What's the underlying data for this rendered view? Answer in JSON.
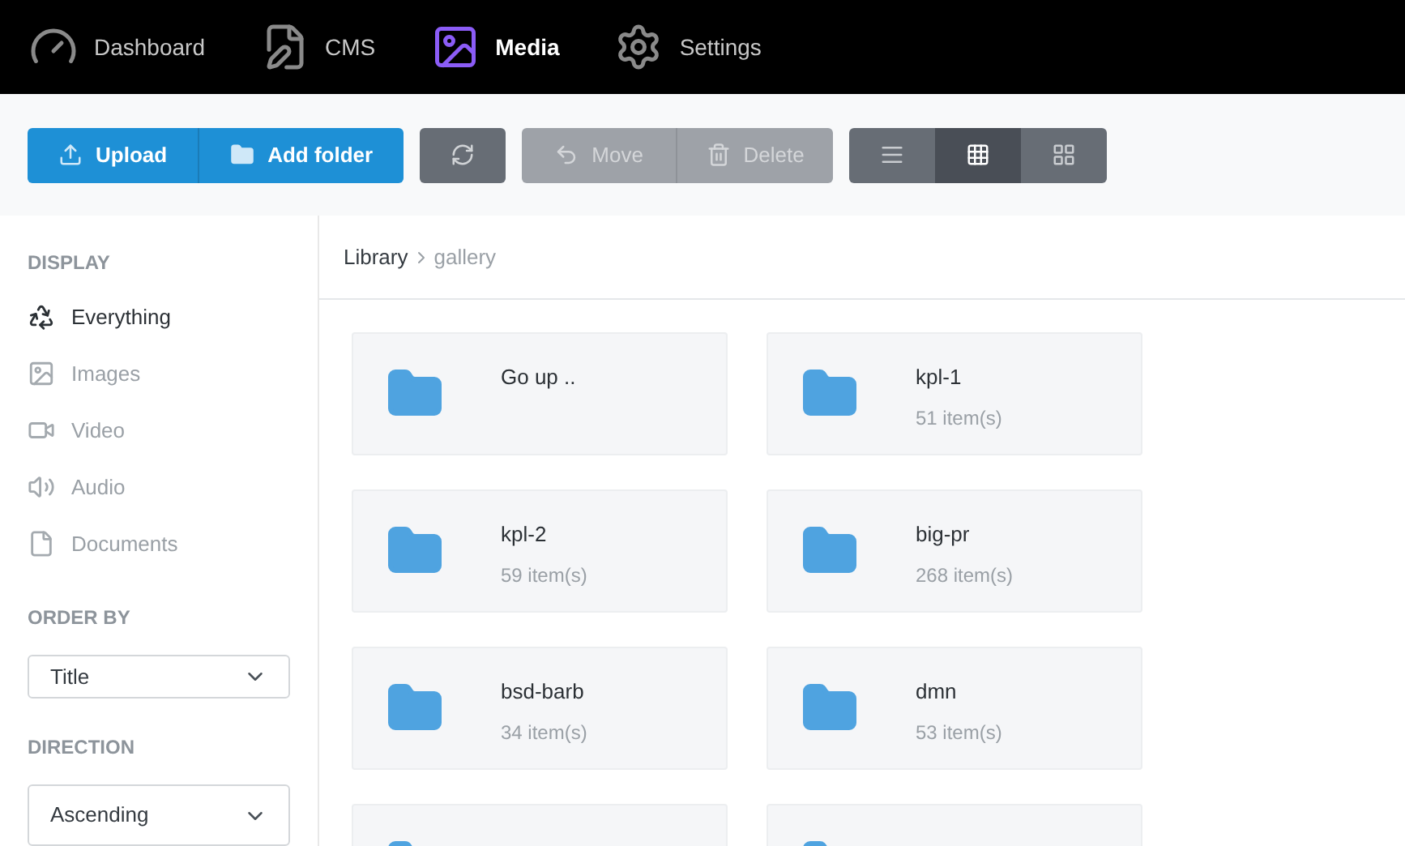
{
  "nav": [
    {
      "label": "Dashboard",
      "selected": false
    },
    {
      "label": "CMS",
      "selected": false
    },
    {
      "label": "Media",
      "selected": true
    },
    {
      "label": "Settings",
      "selected": false
    }
  ],
  "toolbar": {
    "actions": [
      {
        "label": "Upload"
      },
      {
        "label": "Add folder"
      }
    ],
    "edit_actions": [
      {
        "label": "Move",
        "disabled": true
      },
      {
        "label": "Delete",
        "disabled": true
      }
    ],
    "views": [
      {
        "selected": false
      },
      {
        "selected": true
      },
      {
        "selected": false
      }
    ]
  },
  "sidebar": {
    "display_heading": "DISPLAY",
    "display_items": [
      {
        "label": "Everything",
        "selected": true
      },
      {
        "label": "Images",
        "selected": false
      },
      {
        "label": "Video",
        "selected": false
      },
      {
        "label": "Audio",
        "selected": false
      },
      {
        "label": "Documents",
        "selected": false
      }
    ],
    "order_heading": "ORDER BY",
    "order_value": "Title",
    "direction_heading": "DIRECTION",
    "direction_value": "Ascending"
  },
  "breadcrumb": [
    {
      "label": "Library",
      "current": false
    },
    {
      "label": "gallery",
      "current": true
    }
  ],
  "folders": [
    {
      "name": "Go up .."
    },
    {
      "name": "kpl-1",
      "count": "51 item(s)"
    },
    {
      "name": "kpl-2",
      "count": "59 item(s)"
    },
    {
      "name": "big-pr",
      "count": "268 item(s)"
    },
    {
      "name": "bsd-barb",
      "count": "34 item(s)"
    },
    {
      "name": "dmn",
      "count": "53 item(s)"
    }
  ]
}
